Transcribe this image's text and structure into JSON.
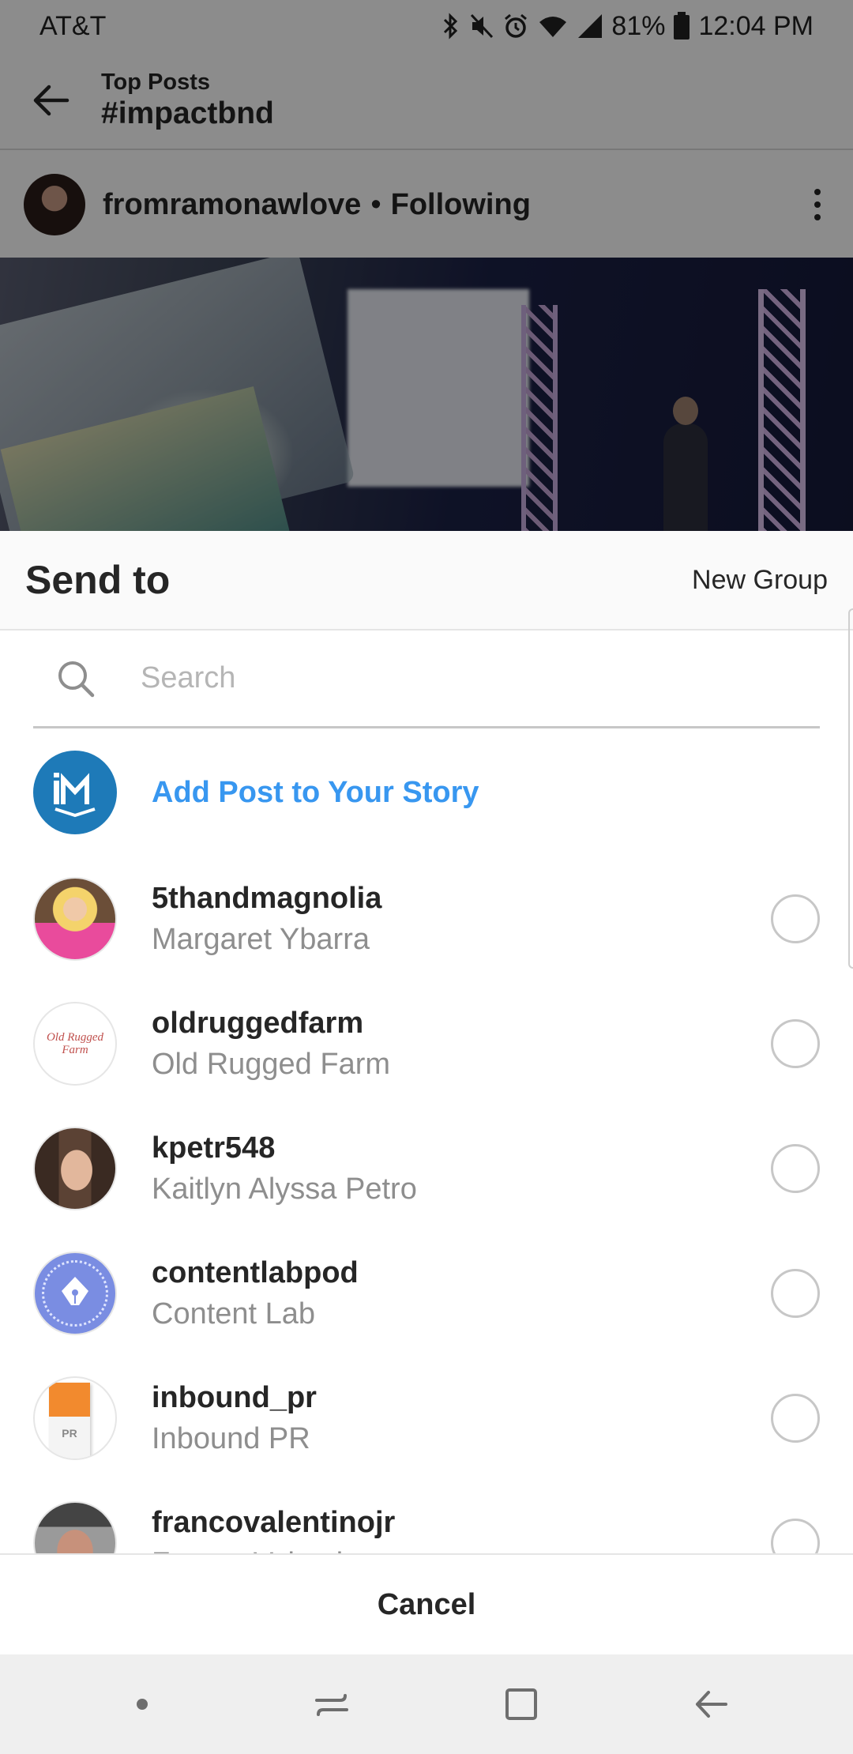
{
  "status_bar": {
    "carrier": "AT&T",
    "battery": "81%",
    "time": "12:04 PM"
  },
  "top_bar": {
    "subtitle": "Top Posts",
    "title": "#impactbnd"
  },
  "post": {
    "username": "fromramonawlove",
    "separator": "•",
    "follow_status": "Following"
  },
  "sheet": {
    "title": "Send to",
    "new_group_label": "New Group",
    "search_placeholder": "Search",
    "story_label": "Add Post to Your Story",
    "contacts": [
      {
        "username": "5thandmagnolia",
        "name": "Margaret Ybarra",
        "selected": false
      },
      {
        "username": "oldruggedfarm",
        "name": "Old Rugged Farm",
        "selected": false
      },
      {
        "username": "kpetr548",
        "name": "Kaitlyn Alyssa Petro",
        "selected": false
      },
      {
        "username": "contentlabpod",
        "name": "Content Lab",
        "selected": false
      },
      {
        "username": "inbound_pr",
        "name": "Inbound PR",
        "selected": false
      },
      {
        "username": "francovalentinojr",
        "name": "Franco Valentino",
        "selected": false
      }
    ],
    "cancel_label": "Cancel"
  },
  "avatar_art": {
    "farm_logo": "Old Rugged Farm",
    "book_label": "PR"
  },
  "colors": {
    "link_blue": "#3897f0",
    "story_avatar": "#1e7ab8",
    "muted_text": "#8e8e8e"
  },
  "icons": {
    "back": "arrow-left-icon",
    "more": "more-vertical-icon",
    "search": "search-icon",
    "radio": "radio-unchecked-icon",
    "nav_dot": "dot-icon",
    "nav_recents": "recents-icon",
    "nav_home": "home-icon",
    "nav_back": "back-icon"
  }
}
